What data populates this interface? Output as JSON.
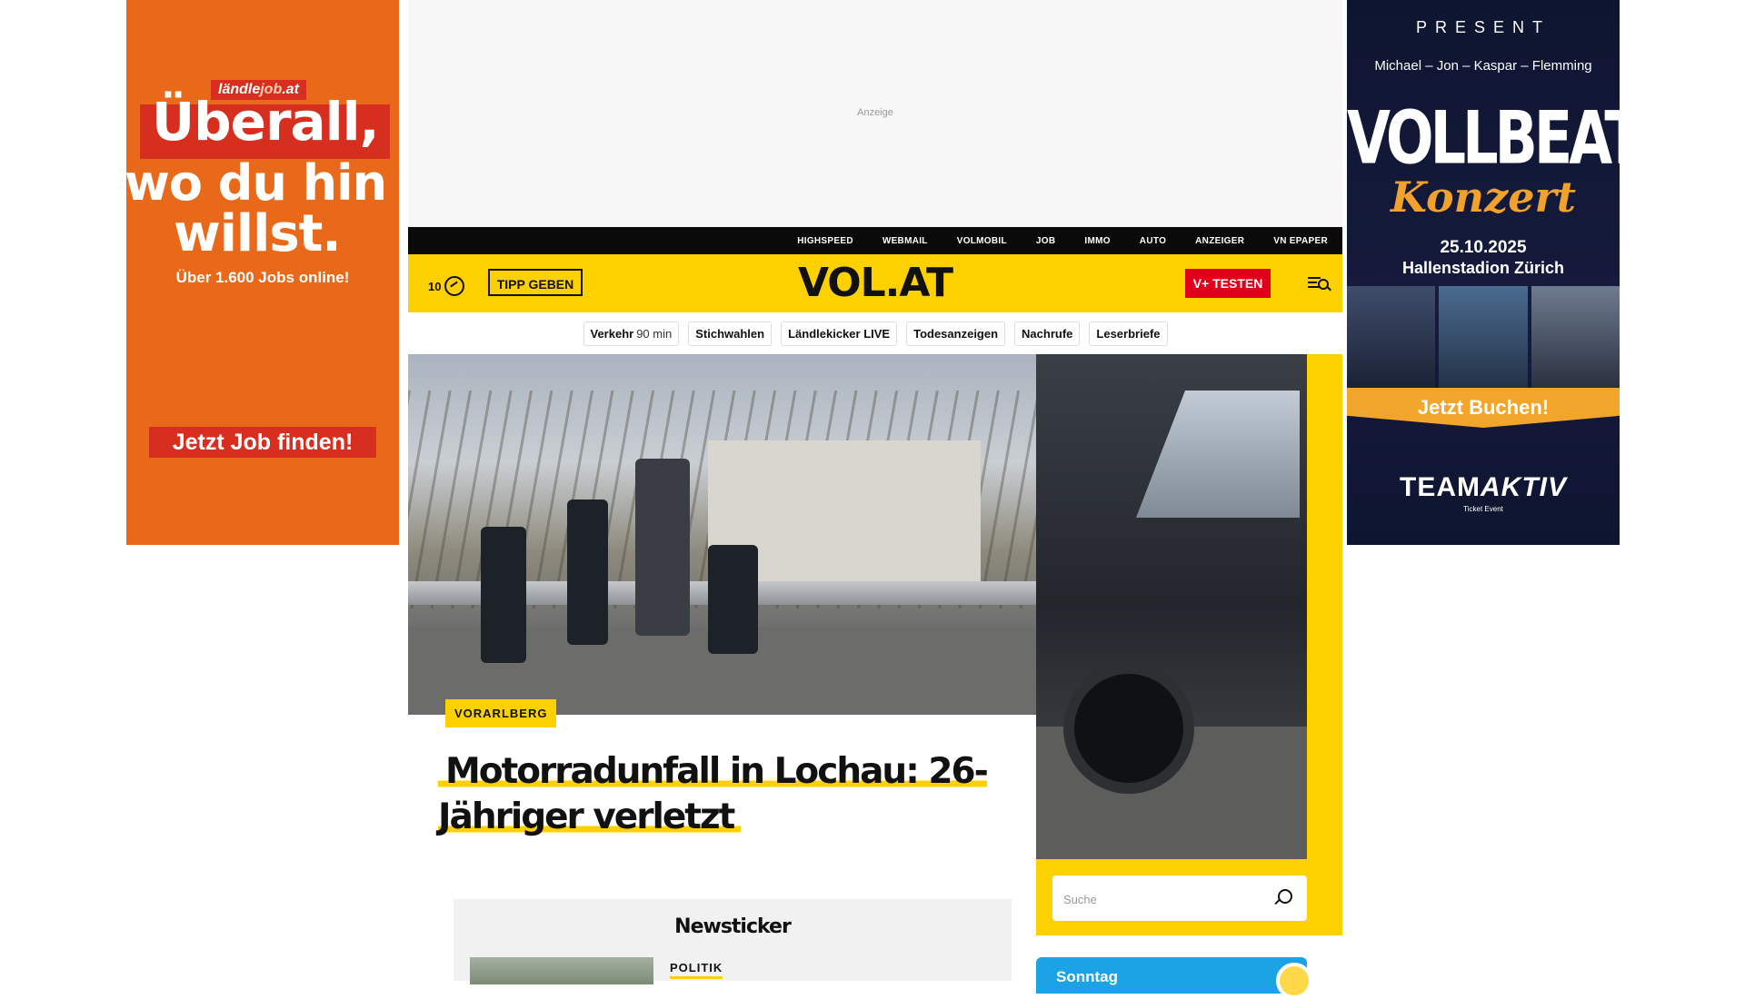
{
  "ads": {
    "top_label": "Anzeige",
    "left": {
      "brand_prefix": "ländle",
      "brand_accent": "job",
      "brand_suffix": ".at",
      "line1": "Überall,",
      "line2": "wo du hin",
      "line3": "willst.",
      "subline": "Über 1.600 Jobs online!",
      "cta": "Jetzt Job finden!"
    },
    "right": {
      "present": "PRESENT",
      "names": "Michael –  Jon –  Kaspar – Flemming",
      "band": "VOLLBEAT",
      "konzert": "Konzert",
      "date": "25.10.2025",
      "venue": "Hallenstadion Zürich",
      "cta": "Jetzt Buchen!",
      "organizer_a": "TEAM",
      "organizer_b": "AKTIV",
      "organizer_sub": "Ticket Event"
    }
  },
  "topbar": {
    "links": [
      "HIGHSPEED",
      "WEBMAIL",
      "VOLMOBIL",
      "JOB",
      "IMMO",
      "AUTO",
      "ANZEIGER",
      "VN EPAPER"
    ]
  },
  "header": {
    "counter": "10",
    "tipp_label": "TIPP GEBEN",
    "logo": "VOL.AT",
    "vplus_label": "V+ TESTEN",
    "icons": {
      "counter": "clock-icon",
      "menu": "menu-search-icon"
    }
  },
  "chips": {
    "traffic_label": "Verkehr",
    "traffic_value": "90 min",
    "items": [
      "Stichwahlen",
      "Ländlekicker LIVE",
      "Todesanzeigen",
      "Nachrufe",
      "Leserbriefe"
    ]
  },
  "hero": {
    "category": "VORARLBERG",
    "title": "Motorradunfall in Lochau: 26-Jähriger verletzt"
  },
  "search": {
    "placeholder": "Suche"
  },
  "newsticker": {
    "heading": "Newsticker",
    "first_category": "POLITIK"
  },
  "weather": {
    "day": "Sonntag"
  },
  "colors": {
    "brand_yellow": "#fdd000",
    "red": "#e0001b",
    "ad_orange": "#e8691a"
  }
}
